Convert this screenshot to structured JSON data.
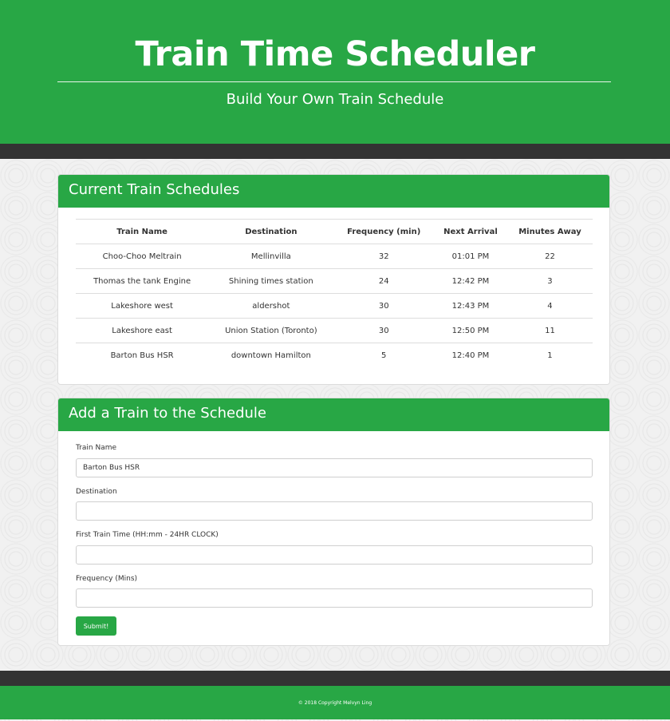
{
  "header": {
    "title": "Train Time Scheduler",
    "subtitle": "Build Your Own Train Schedule"
  },
  "schedules": {
    "heading": "Current Train Schedules",
    "columns": [
      "Train Name",
      "Destination",
      "Frequency (min)",
      "Next Arrival",
      "Minutes Away"
    ],
    "rows": [
      [
        "Choo-Choo Meltrain",
        "Mellinvilla",
        "32",
        "01:01 PM",
        "22"
      ],
      [
        "Thomas the tank Engine",
        "Shining times station",
        "24",
        "12:42 PM",
        "3"
      ],
      [
        "Lakeshore west",
        "aldershot",
        "30",
        "12:43 PM",
        "4"
      ],
      [
        "Lakeshore east",
        "Union Station (Toronto)",
        "30",
        "12:50 PM",
        "11"
      ],
      [
        "Barton Bus HSR",
        "downtown Hamilton",
        "5",
        "12:40 PM",
        "1"
      ]
    ]
  },
  "form": {
    "heading": "Add a Train to the Schedule",
    "train_name_label": "Train Name",
    "train_name_value": "Barton Bus HSR",
    "destination_label": "Destination",
    "destination_value": "",
    "first_time_label": "First Train Time (HH:mm - 24HR CLOCK)",
    "first_time_value": "",
    "frequency_label": "Frequency (Mins)",
    "frequency_value": "",
    "submit_label": "Submit!"
  },
  "footer": {
    "copyright": "© 2018 Copyright Melvyn Ling"
  },
  "colors": {
    "accent": "#28a745",
    "band": "#333333"
  }
}
